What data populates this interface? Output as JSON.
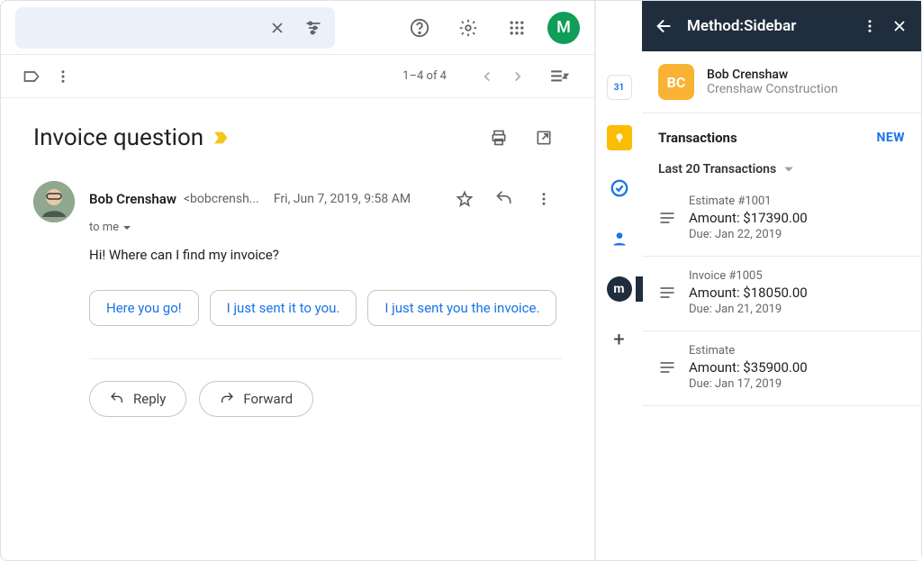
{
  "header": {
    "avatar_letter": "M"
  },
  "toolbar": {
    "pager_text": "1–4 of 4"
  },
  "email": {
    "subject": "Invoice question",
    "sender_name": "Bob Crenshaw",
    "sender_email": "<bobcrensh...",
    "date": "Fri, Jun 7, 2019, 9:58 AM",
    "to_line": "to me",
    "body": "Hi! Where can I find my invoice?",
    "suggestions": [
      "Here you go!",
      "I just sent it to you.",
      "I just sent you the invoice."
    ],
    "reply_label": "Reply",
    "forward_label": "Forward"
  },
  "sidebar": {
    "title": "Method:Sidebar",
    "contact": {
      "initials": "BC",
      "name": "Bob Crenshaw",
      "company": "Crenshaw Construction"
    },
    "section_title": "Transactions",
    "new_label": "NEW",
    "filter_label": "Last 20 Transactions",
    "transactions": [
      {
        "title": "Estimate #1001",
        "amount": "Amount: $17390.00",
        "due": "Due: Jan 22, 2019"
      },
      {
        "title": "Invoice #1005",
        "amount": "Amount: $18050.00",
        "due": "Due: Jan 21, 2019"
      },
      {
        "title": "Estimate",
        "amount": "Amount: $35900.00",
        "due": "Due: Jan 17, 2019"
      }
    ]
  }
}
